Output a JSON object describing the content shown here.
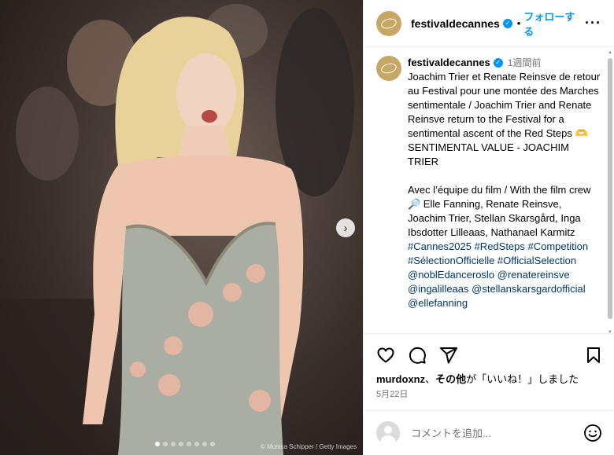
{
  "post": {
    "username": "festivaldecannes",
    "separator": "•",
    "follow_label": "フォローする",
    "more_label": "···",
    "icons": {
      "verified": "verified-badge-icon",
      "like": "heart-icon",
      "comment": "comment-icon",
      "share": "send-icon",
      "save": "bookmark-icon",
      "emoji": "emoji-icon",
      "next": "chevron-right-icon"
    },
    "colors": {
      "accent": "#0095f6",
      "hashtag": "#00376b",
      "avatar": "#c7a766"
    }
  },
  "photo": {
    "credit": "© Monica Schipper / Getty Images",
    "next_label": "›",
    "slide_count": 8,
    "active_slide": 1
  },
  "caption": {
    "username": "festivaldecannes",
    "time": "1週間前",
    "text": "Joachim Trier et Renate Reinsve de retour au Festival pour une montée des Marches sentimentale / Joachim Trier and Renate Reinsve return to the Festival for a sentimental ascent of the Red Steps 🫶 SENTIMENTAL VALUE - JOACHIM TRIER\n\nAvec l’équipe du film / With the film crew\n🔎 Elle Fanning, Renate Reinsve, Joachim Trier, Stellan Skarsgård, Inga Ibsdotter Lilleaas, Nathanael Karmitz\n",
    "tags": "#Cannes2025 #RedSteps #Competition #SélectionOfficielle #OfficialSelection @noblEdanceroslo @renatereinsve @ingalilleaas @stellanskarsgardofficial @ellefanning"
  },
  "likes": {
    "user": "murdoxnz",
    "middle": "、",
    "others": "その他",
    "suffix": "が「いいね！」しました"
  },
  "date": "5月22日",
  "comment": {
    "placeholder": "コメントを追加..."
  }
}
